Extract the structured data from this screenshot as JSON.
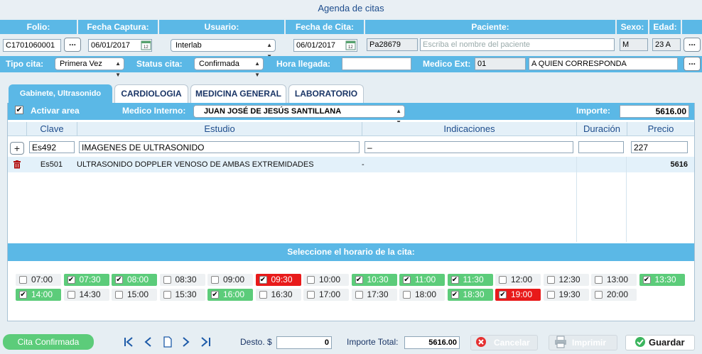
{
  "title": "Agenda de citas",
  "header": {
    "folio_label": "Folio:",
    "fecha_captura_label": "Fecha Captura:",
    "usuario_label": "Usuario:",
    "fecha_cita_label": "Fecha de Cita:",
    "paciente_label": "Paciente:",
    "sexo_label": "Sexo:",
    "edad_label": "Edad:"
  },
  "fields": {
    "folio": "C1701060001",
    "fecha_captura": "06/01/2017",
    "usuario": "Interlab",
    "fecha_cita": "06/01/2017",
    "paciente_id": "Pa28679",
    "paciente_placeholder": "Escriba el nombre del paciente",
    "sexo": "M",
    "edad": "23 A",
    "more": "..."
  },
  "row2": {
    "tipo_cita_label": "Tipo cita:",
    "tipo_cita": "Primera Vez",
    "status_label": "Status cita:",
    "status": "Confirmada",
    "hora_llegada_label": "Hora llegada:",
    "hora_llegada": "",
    "medico_ext_label": "Medico Ext:",
    "medico_ext_id": "01",
    "medico_ext_name": "A QUIEN CORRESPONDA"
  },
  "tabs": [
    "Gabinete, Ultrasonido",
    "CARDIOLOGIA",
    "MEDICINA GENERAL",
    "LABORATORIO"
  ],
  "area": {
    "activar_label": "Activar area",
    "medico_interno_label": "Medico Interno:",
    "medico_interno": "JUAN JOSÉ DE JESÚS SANTILLANA",
    "importe_label": "Importe:",
    "importe": "5616.00"
  },
  "table": {
    "headers": [
      "Clave",
      "Estudio",
      "Indicaciones",
      "Duración",
      "Precio"
    ],
    "input_row": {
      "clave": "Es492",
      "estudio": "IMAGENES DE ULTRASONIDO",
      "indicaciones": "–",
      "duracion": "",
      "precio": "227"
    },
    "rows": [
      {
        "clave": "Es501",
        "estudio": "ULTRASONIDO DOPPLER VENOSO DE AMBAS EXTREMIDADES",
        "indicaciones": "-",
        "duracion": "",
        "precio": "5616"
      }
    ]
  },
  "horario": {
    "title": "Seleccione el horario de la cita:",
    "slots": [
      {
        "time": "07:00",
        "state": "none"
      },
      {
        "time": "07:30",
        "state": "green"
      },
      {
        "time": "08:00",
        "state": "green"
      },
      {
        "time": "08:30",
        "state": "none"
      },
      {
        "time": "09:00",
        "state": "none"
      },
      {
        "time": "09:30",
        "state": "red"
      },
      {
        "time": "10:00",
        "state": "none"
      },
      {
        "time": "10:30",
        "state": "green"
      },
      {
        "time": "11:00",
        "state": "green"
      },
      {
        "time": "11:30",
        "state": "green"
      },
      {
        "time": "12:00",
        "state": "none"
      },
      {
        "time": "12:30",
        "state": "none"
      },
      {
        "time": "13:00",
        "state": "none"
      },
      {
        "time": "13:30",
        "state": "green"
      },
      {
        "time": "14:00",
        "state": "green"
      },
      {
        "time": "14:30",
        "state": "none"
      },
      {
        "time": "15:00",
        "state": "none"
      },
      {
        "time": "15:30",
        "state": "none"
      },
      {
        "time": "16:00",
        "state": "green"
      },
      {
        "time": "16:30",
        "state": "none"
      },
      {
        "time": "17:00",
        "state": "none"
      },
      {
        "time": "17:30",
        "state": "none"
      },
      {
        "time": "18:00",
        "state": "none"
      },
      {
        "time": "18:30",
        "state": "green"
      },
      {
        "time": "19:00",
        "state": "red"
      },
      {
        "time": "19:30",
        "state": "none"
      },
      {
        "time": "20:00",
        "state": "none"
      }
    ]
  },
  "footer": {
    "status_badge": "Cita Confirmada",
    "desto_label": "Desto. $",
    "desto": "0",
    "importe_total_label": "Importe Total:",
    "importe_total": "5616.00",
    "cancelar": "Cancelar",
    "imprimir": "Imprimir",
    "guardar": "Guardar"
  },
  "colors": {
    "accent": "#5bb8e6",
    "green_slot": "#5ccc7a",
    "red_slot": "#e81a1a"
  }
}
